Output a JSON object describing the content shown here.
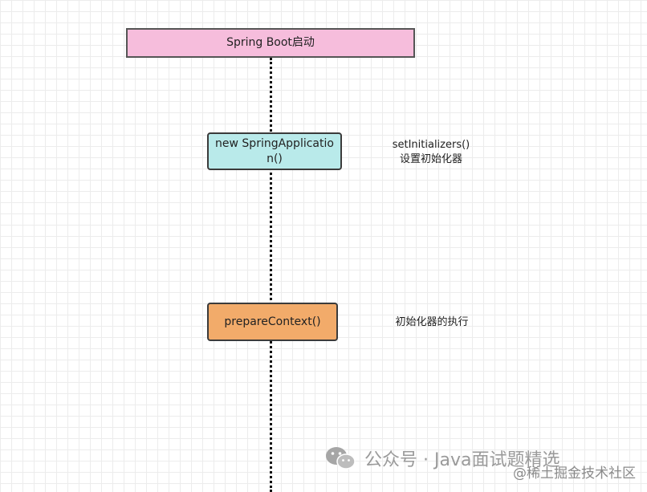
{
  "diagram": {
    "title": "Spring Boot启动",
    "steps": [
      {
        "label": "new SpringApplication()",
        "note": [
          "setInitializers()",
          "设置初始化器"
        ]
      },
      {
        "label": "prepareContext()",
        "note": [
          "初始化器的执行"
        ]
      }
    ]
  },
  "watermark": {
    "text": "公众号 · Java面试题精选",
    "sub": "@稀土掘金技术社区",
    "icon": "wechat-icon"
  },
  "colors": {
    "title_fill": "#f6bddc",
    "step1_fill": "#b9eaea",
    "step2_fill": "#f2ab6a"
  }
}
